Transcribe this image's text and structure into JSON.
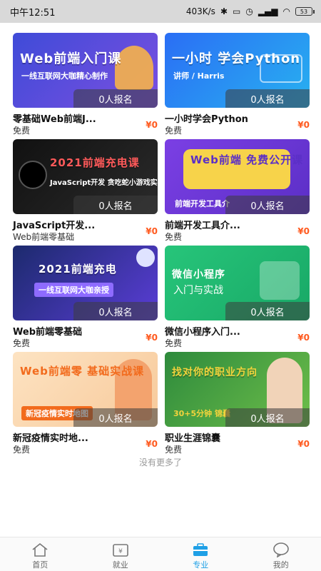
{
  "status": {
    "time": "中午12:51",
    "speed": "403K/s",
    "battery": "53"
  },
  "courses": [
    {
      "l1": "Web前端入门课",
      "l2": "一线互联网大咖精心制作",
      "enroll": "0人报名",
      "title": "零基础Web前端J...",
      "sub": "免费",
      "price": "¥0"
    },
    {
      "l1": "一小时 学会Python",
      "l2": "讲师 / Harris",
      "enroll": "0人报名",
      "title": "一小时学会Python",
      "sub": "免费",
      "price": "¥0"
    },
    {
      "l1": "2021前端充电课",
      "l2": "JavaScript开发 贪吃蛇小游戏实战",
      "enroll": "0人报名",
      "title": "JavaScript开发...",
      "sub": "Web前端零基础",
      "price": "¥0"
    },
    {
      "l1": "Web前端 免费公开课",
      "l2": "前端开发工具介",
      "enroll": "0人报名",
      "title": "前端开发工具介...",
      "sub": "免费",
      "price": "¥0"
    },
    {
      "l1": "2021前端充电",
      "l2": "一线互联网大咖亲授",
      "enroll": "0人报名",
      "title": "Web前端零基础",
      "sub": "免费",
      "price": "¥0"
    },
    {
      "l1": "微信小程序",
      "l2": "入门与实战",
      "enroll": "0人报名",
      "title": "微信小程序入门...",
      "sub": "免费",
      "price": "¥0"
    },
    {
      "l1": "Web前端零 基础实战课",
      "l2": "新冠疫情实时地图",
      "enroll": "0人报名",
      "title": "新冠疫情实时地...",
      "sub": "免费",
      "price": "¥0"
    },
    {
      "l1": "找对你的职业方向",
      "l2": "30+5分钟 锦囊",
      "enroll": "0人报名",
      "title": "职业生涯锦囊",
      "sub": "免费",
      "price": "¥0"
    }
  ],
  "footer_text": "没有更多了",
  "tabs": [
    {
      "label": "首页",
      "icon": "home-icon"
    },
    {
      "label": "就业",
      "icon": "wallet-icon"
    },
    {
      "label": "专业",
      "icon": "briefcase-icon"
    },
    {
      "label": "我的",
      "icon": "chat-bubble-icon"
    }
  ],
  "colors": {
    "accent": "#1fa0e6",
    "price": "#ff5a1f"
  }
}
